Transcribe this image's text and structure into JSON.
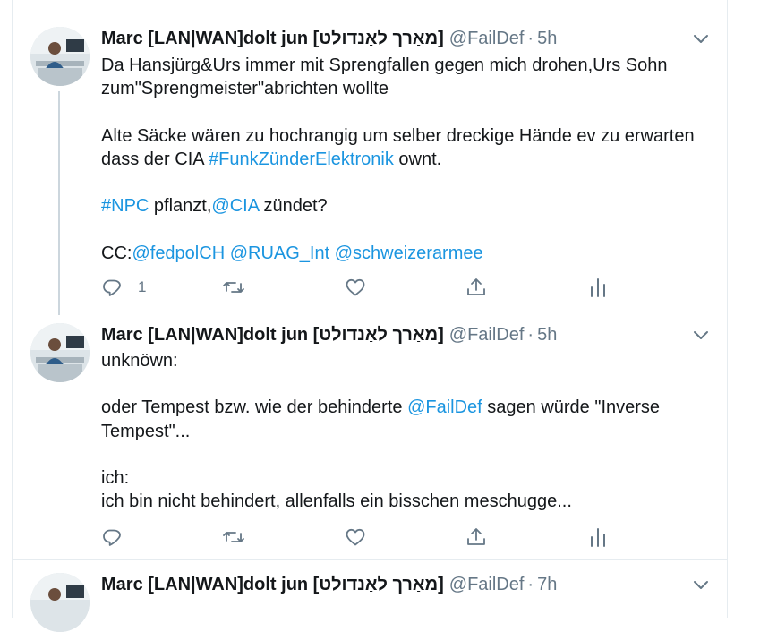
{
  "tweets": [
    {
      "name": "Marc [LAN|WAN]dolt jun [מאַרך לאַנדולט]",
      "handle": "@FailDef",
      "separator": "·",
      "time": "5h",
      "lines": [
        {
          "text": "Da Hansjürg&Urs immer mit Sprengfallen gegen mich drohen,Urs Sohn"
        },
        {
          "text": "zum\"Sprengmeister\"abrichten wollte"
        },
        {
          "text": "Alte Säcke wären zu hochrangig um selber dreckige Hände ev zu erwarten"
        },
        {
          "pre": "dass der CIA ",
          "link": "#FunkZünderElektronik",
          "post": " ownt."
        },
        {
          "hashtag": "#NPC",
          "mid": " pflanzt,",
          "mention": "@CIA",
          "post": " zündet?"
        },
        {
          "prefix": "CC:",
          "m1": "@fedpolCH",
          "m2": "@RUAG_Int",
          "m3": "@schweizerarmee"
        }
      ],
      "reply_count": "1",
      "has_thread": true
    },
    {
      "name": "Marc [LAN|WAN]dolt jun [מאַרך לאַנדולט]",
      "handle": "@FailDef",
      "separator": "·",
      "time": "5h",
      "lines": [
        {
          "text": "unknöwn:"
        },
        {
          "pre": "oder Tempest bzw. wie der behinderte ",
          "link": "@FailDef",
          "post": " sagen würde \"Inverse"
        },
        {
          "text": "Tempest\"..."
        },
        {
          "text": "ich:"
        },
        {
          "text": "ich bin nicht behindert, allenfalls ein bisschen meschugge..."
        }
      ],
      "reply_count": ""
    },
    {
      "name": "Marc [LAN|WAN]dolt jun [מאַרך לאַנדולט]",
      "handle": "@FailDef",
      "separator": "·",
      "time": "7h"
    }
  ],
  "icons": {
    "reply": "reply-icon",
    "retweet": "retweet-icon",
    "like": "heart-icon",
    "share": "share-icon",
    "analytics": "analytics-icon",
    "caret": "chevron-down-icon"
  },
  "colors": {
    "link": "#1b95e0",
    "text": "#14171a",
    "secondary": "#657786",
    "border": "#e6ecf0",
    "thread_line": "#ccd6dd"
  }
}
